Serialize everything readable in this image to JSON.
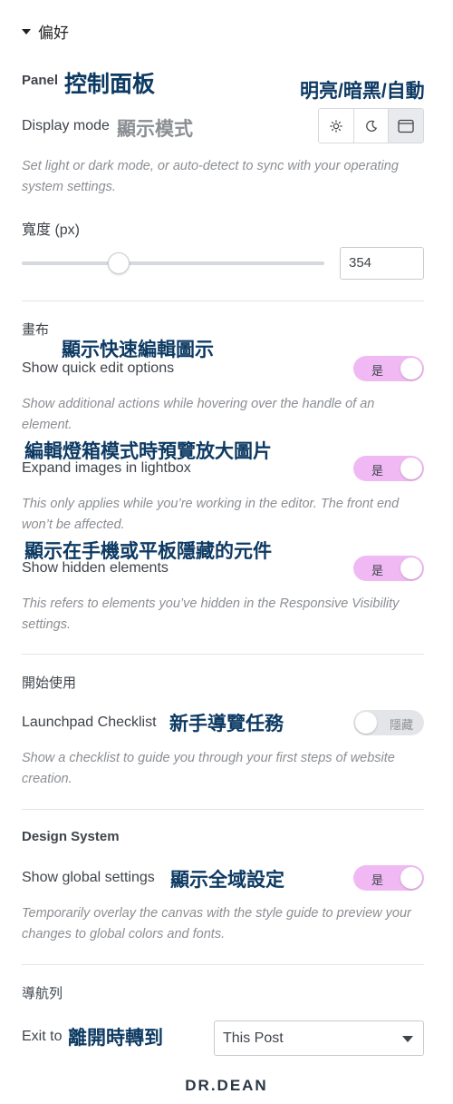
{
  "header": {
    "title": "偏好"
  },
  "panel": {
    "title": "Panel",
    "annotation": "控制面板",
    "mode_annotation": "明亮/暗黑/自動",
    "display_mode": {
      "label": "Display mode",
      "annotation": "顯示模式",
      "options": [
        "light",
        "dark",
        "auto"
      ],
      "selected": "auto",
      "desc": "Set light or dark mode, or auto-detect to sync with your operating system settings."
    },
    "width": {
      "label": "寬度 (px)",
      "value": "354",
      "slider_fraction": 0.32
    }
  },
  "canvas": {
    "title": "畫布",
    "quick_edit": {
      "annotation": "顯示快速編輯圖示",
      "label": "Show quick edit options",
      "toggle": "是",
      "desc": "Show additional actions while hovering over the handle of an element."
    },
    "lightbox": {
      "annotation": "編輯燈箱模式時預覽放大圖片",
      "label": "Expand images in lightbox",
      "toggle": "是",
      "desc": "This only applies while you’re working in the editor. The front end won’t be affected."
    },
    "hidden": {
      "annotation": "顯示在手機或平板隱藏的元件",
      "label": "Show hidden elements",
      "toggle": "是",
      "desc": "This refers to elements you’ve hidden in the Responsive Visibility settings."
    }
  },
  "getting_started": {
    "title": "開始使用",
    "launchpad": {
      "label": "Launchpad Checklist",
      "annotation": "新手導覽任務",
      "toggle": "隱藏",
      "desc": "Show a checklist to guide you through your first steps of website creation."
    }
  },
  "design_system": {
    "title": "Design System",
    "global": {
      "label": "Show global settings",
      "annotation": "顯示全域設定",
      "toggle": "是",
      "desc": "Temporarily overlay the canvas with the style guide to preview your changes to global colors and fonts."
    }
  },
  "navigator": {
    "title": "導航列",
    "exit": {
      "label": "Exit to",
      "annotation": "離開時轉到",
      "value": "This Post"
    }
  },
  "logo": {
    "text": "DR.DEAN"
  },
  "colors": {
    "toggle_on": "#f1b9f3",
    "annotation": "#0d3a63"
  }
}
